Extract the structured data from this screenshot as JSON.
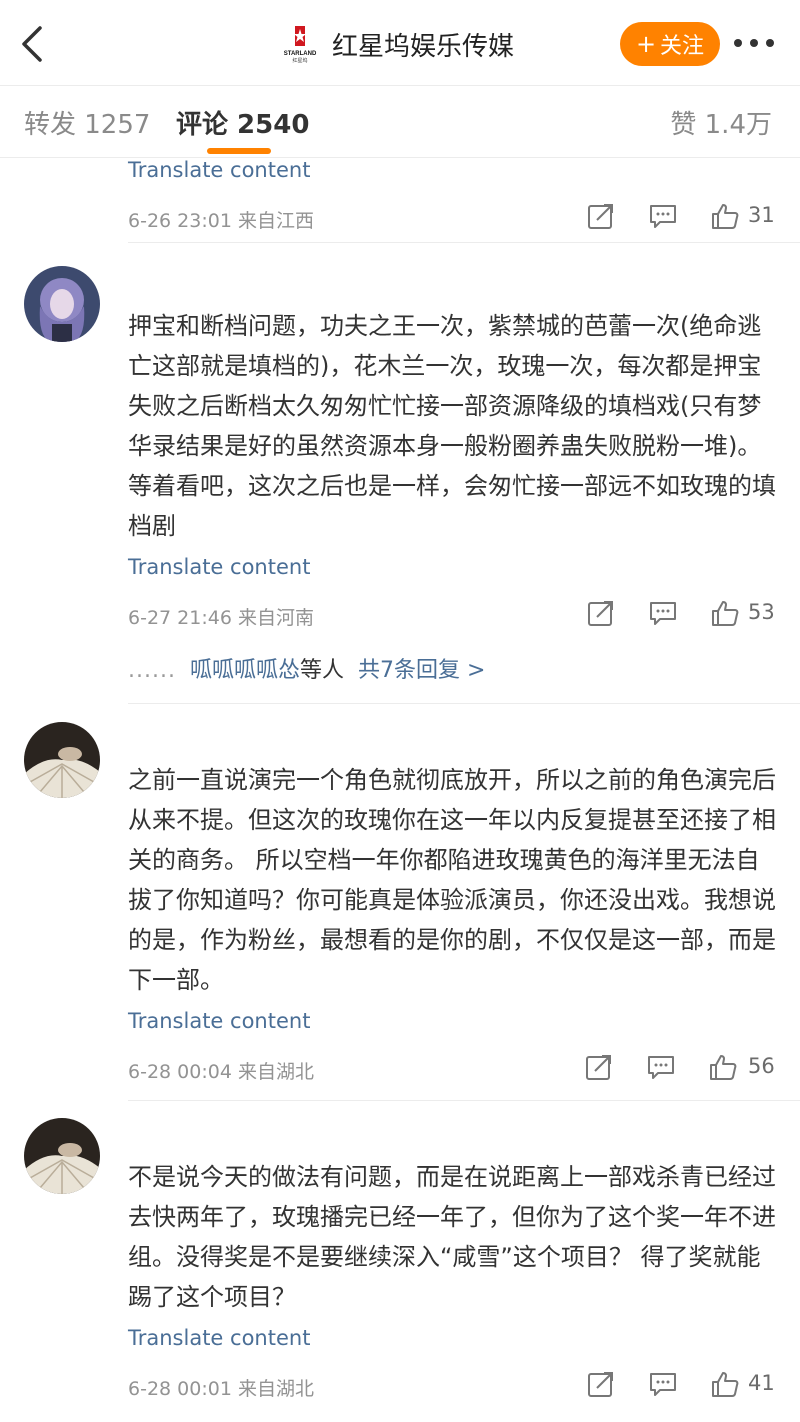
{
  "header": {
    "title": "红星坞娱乐传媒",
    "logo_text": "STARLAND",
    "logo_subtext": "红星坞",
    "follow_label": "关注",
    "brand_color": "#ff8200"
  },
  "tabs": [
    {
      "label": "转发 1257"
    },
    {
      "label": "评论 2540",
      "active": true
    },
    {
      "label": "赞 1.4万"
    }
  ],
  "comments": [
    {
      "text": "",
      "translate": "Translate content",
      "meta": "6-26 23:01 来自江西",
      "likes": "31"
    },
    {
      "avatar": "purple-hair-girl",
      "text": "押宝和断档问题，功夫之王一次，紫禁城的芭蕾一次(绝命逃亡这部就是填档的)，花木兰一次，玫瑰一次，每次都是押宝失败之后断档太久匆匆忙忙接一部资源降级的填档戏(只有梦华录结果是好的虽然资源本身一般粉圈养蛊失败脱粉一堆)。等着看吧，这次之后也是一样，会匆忙接一部远不如玫瑰的填档剧",
      "translate": "Translate content",
      "meta": "6-27 21:46 来自河南",
      "likes": "53",
      "replies": {
        "dots": "......",
        "names": "呱呱呱呱怂",
        "suffix": "等人",
        "link": "共7条回复 >"
      }
    },
    {
      "avatar": "hand-lace",
      "text": "之前一直说演完一个角色就彻底放开，所以之前的角色演完后从来不提。但这次的玫瑰你在这一年以内反复提甚至还接了相关的商务。 所以空档一年你都陷进玫瑰黄色的海洋里无法自拔了你知道吗？你可能真是体验派演员，你还没出戏。我想说的是，作为粉丝，最想看的是你的剧，不仅仅是这一部，而是下一部。",
      "translate": "Translate content",
      "meta": "6-28 00:04 来自湖北",
      "likes": "56"
    },
    {
      "avatar": "hand-lace",
      "text": "不是说今天的做法有问题，而是在说距离上一部戏杀青已经过去快两年了，玫瑰播完已经一年了，但你为了这个奖一年不进组。没得奖是不是要继续深入“咸雪”这个项目？ 得了奖就能踢了这个项目？",
      "translate": "Translate content",
      "meta": "6-28 00:01 来自湖北",
      "likes": "41"
    }
  ]
}
